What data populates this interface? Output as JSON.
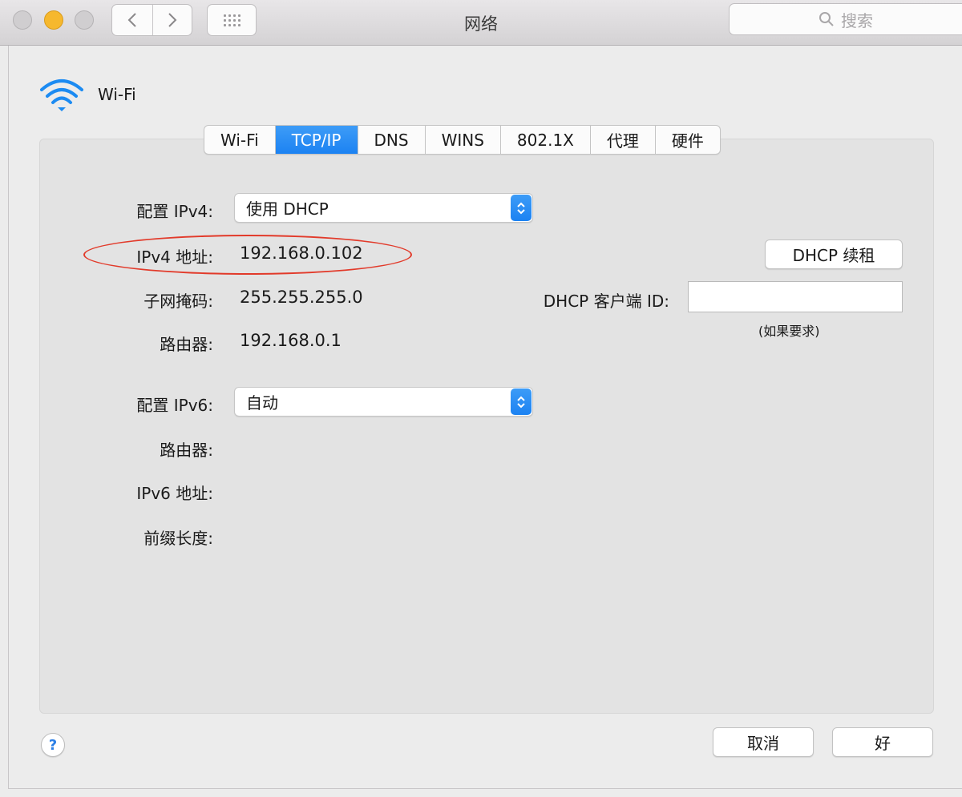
{
  "window": {
    "title": "网络",
    "search_placeholder": "搜索",
    "nav_back_icon": "chevron-left-icon",
    "nav_forward_icon": "chevron-right-icon",
    "grid_icon": "grid-icon"
  },
  "header": {
    "service_name": "Wi-Fi",
    "service_icon": "wifi-icon"
  },
  "tabs": [
    {
      "label": "Wi-Fi",
      "active": false
    },
    {
      "label": "TCP/IP",
      "active": true
    },
    {
      "label": "DNS",
      "active": false
    },
    {
      "label": "WINS",
      "active": false
    },
    {
      "label": "802.1X",
      "active": false
    },
    {
      "label": "代理",
      "active": false
    },
    {
      "label": "硬件",
      "active": false
    }
  ],
  "ipv4": {
    "config_label": "配置 IPv4:",
    "config_value": "使用 DHCP",
    "address_label": "IPv4 地址:",
    "address_value": "192.168.0.102",
    "subnet_label": "子网掩码:",
    "subnet_value": "255.255.255.0",
    "router_label": "路由器:",
    "router_value": "192.168.0.1"
  },
  "dhcp": {
    "renew_label": "DHCP 续租",
    "client_id_label": "DHCP 客户端 ID:",
    "client_id_value": "",
    "client_id_hint": "(如果要求)"
  },
  "ipv6": {
    "config_label": "配置 IPv6:",
    "config_value": "自动",
    "router_label": "路由器:",
    "address_label": "IPv6 地址:",
    "prefix_label": "前缀长度:"
  },
  "footer": {
    "help_label": "?",
    "cancel_label": "取消",
    "ok_label": "好"
  },
  "colors": {
    "accent": "#1c82f2",
    "highlight_ellipse": "#e23a2a",
    "minimize": "#f6b82e"
  }
}
